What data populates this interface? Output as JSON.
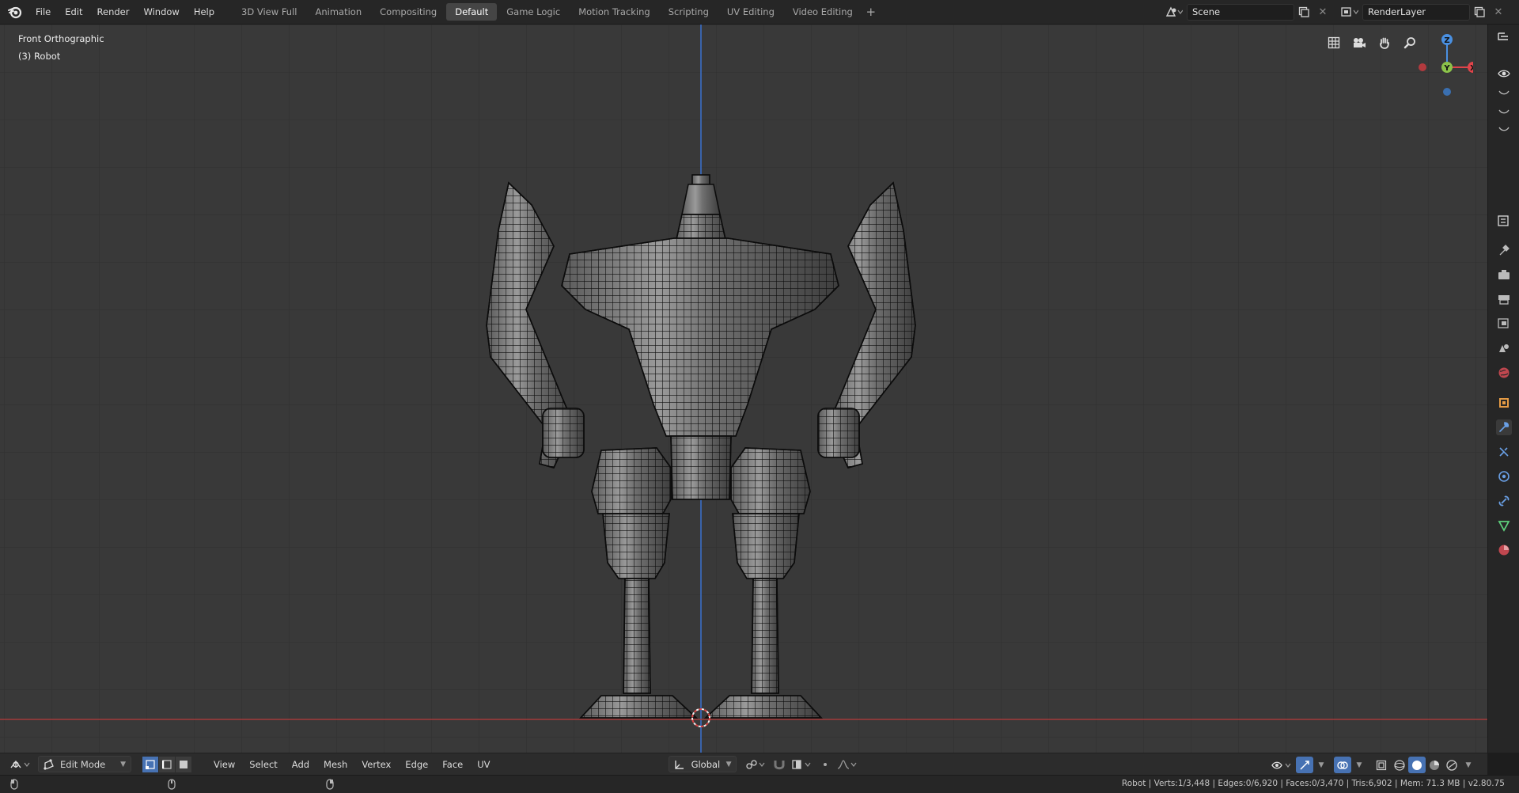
{
  "menu": {
    "items": [
      "File",
      "Edit",
      "Render",
      "Window",
      "Help"
    ]
  },
  "workspaces": {
    "tabs": [
      "3D View Full",
      "Animation",
      "Compositing",
      "Default",
      "Game Logic",
      "Motion Tracking",
      "Scripting",
      "UV Editing",
      "Video Editing"
    ],
    "active": "Default",
    "add_label": "+"
  },
  "scene": {
    "value": "Scene"
  },
  "render_layer": {
    "value": "RenderLayer"
  },
  "viewport": {
    "view_name": "Front Orthographic",
    "object_label": "(3) Robot",
    "gizmo": {
      "z": "Z",
      "y": "Y",
      "x": "X"
    },
    "grid_color": "#2f2f2f",
    "background": "#393939",
    "x_axis_color": "#a33a3a",
    "z_axis_color": "#3a6ec8"
  },
  "header": {
    "mode": "Edit Mode",
    "menus": [
      "View",
      "Select",
      "Add",
      "Mesh",
      "Vertex",
      "Edge",
      "Face",
      "UV"
    ],
    "orientation": "Global"
  },
  "status": {
    "stats": "Robot | Verts:1/3,448 | Edges:0/6,920 | Faces:0/3,470 | Tris:6,902 | Mem: 71.3 MB | v2.80.75"
  },
  "colors": {
    "accent": "#4772b3",
    "x_red": "#e0444a",
    "y_green": "#8bc34a",
    "z_blue": "#4a90e2"
  }
}
